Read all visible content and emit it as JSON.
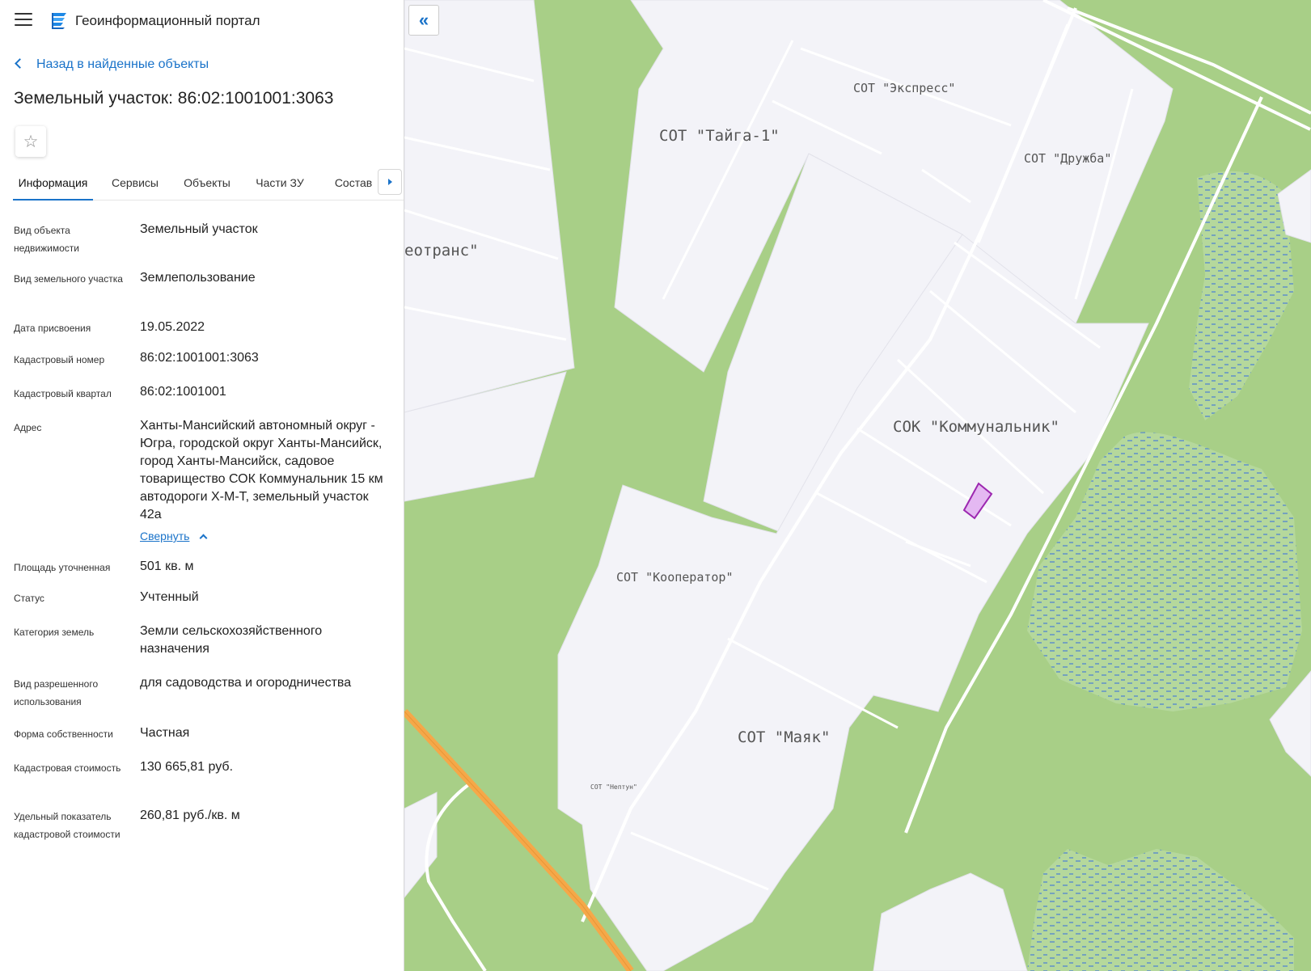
{
  "header": {
    "app_title": "Геоинформационный портал",
    "menu_icon": "hamburger-menu-icon",
    "logo_icon": "portal-logo-icon"
  },
  "back_link": "Назад в найденные объекты",
  "object_title": "Земельный участок: 86:02:1001001:3063",
  "favorite_icon": "star-icon",
  "tabs": [
    {
      "label": "Информация",
      "active": true
    },
    {
      "label": "Сервисы"
    },
    {
      "label": "Объекты"
    },
    {
      "label": "Части ЗУ"
    },
    {
      "label": "Состав"
    }
  ],
  "properties": [
    {
      "label": "Вид объекта недвижимости",
      "value": "Земельный участок"
    },
    {
      "label": "Вид земельного участка",
      "value": "Землепользование"
    },
    {
      "label": "Дата присвоения",
      "value": "19.05.2022"
    },
    {
      "label": "Кадастровый номер",
      "value": "86:02:1001001:3063"
    },
    {
      "label": "Кадастровый квартал",
      "value": "86:02:1001001"
    },
    {
      "label": "Адрес",
      "value": "Ханты-Мансийский автономный округ - Югра, городской округ Ханты-Мансийск, город Ханты-Мансийск, садовое товарищество СОК Коммунальник 15 км автодороги Х-М-Т, земельный участок 42а"
    },
    {
      "label": "Площадь уточненная",
      "value": "501 кв. м"
    },
    {
      "label": "Статус",
      "value": "Учтенный"
    },
    {
      "label": "Категория земель",
      "value": "Земли сельскохозяйственного назначения"
    },
    {
      "label": "Вид разрешенного использования",
      "value": "для садоводства и огородничества"
    },
    {
      "label": "Форма собственности",
      "value": "Частная"
    },
    {
      "label": "Кадастровая стоимость",
      "value": "130 665,81 руб."
    },
    {
      "label": "Удельный показатель кадастровой стоимости",
      "value": "260,81 руб./кв. м"
    }
  ],
  "collapse_link": "Свернуть",
  "map": {
    "collapse_button_glyph": "«",
    "labels": [
      "СОТ \"Тайга-1\"",
      "СОТ \"Экспресс\"",
      "СОТ \"Дружба\"",
      "еотранс\"",
      "СОК \"Коммунальник\"",
      "СОТ \"Кооператор\"",
      "СОТ \"Маяк\"",
      "СОТ \"Нептун\""
    ],
    "colors": {
      "green": "#a8cf87",
      "plot": "#f3f3f8",
      "road": "#f5a849",
      "water_hatch": "#4a7fd6",
      "selected": "#9c27b0"
    }
  }
}
